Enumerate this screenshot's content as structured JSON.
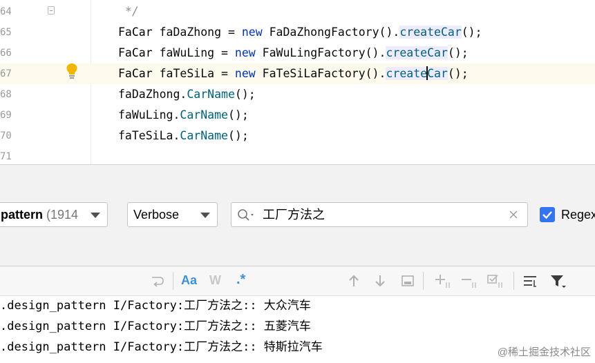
{
  "editor": {
    "lines": [
      {
        "num": "64",
        "comment": " */"
      },
      {
        "num": "65",
        "type": "FaCar",
        "var": "faDaZhong",
        "kw": "new",
        "factory": "FaDaZhongFactory",
        "method": "createCar"
      },
      {
        "num": "66",
        "type": "FaCar",
        "var": "faWuLing",
        "kw": "new",
        "factory": "FaWuLingFactory",
        "method": "createCar"
      },
      {
        "num": "67",
        "type": "FaCar",
        "var": "faTeSiLa",
        "kw": "new",
        "factory": "FaTeSiLaFactory",
        "method_a": "create",
        "method_b": "Car"
      },
      {
        "num": "68",
        "obj": "faDaZhong",
        "call": "CarName"
      },
      {
        "num": "69",
        "obj": "faWuLing",
        "call": "CarName"
      },
      {
        "num": "70",
        "obj": "faTeSiLa",
        "call": "CarName"
      },
      {
        "num": "71"
      }
    ]
  },
  "logcat": {
    "process_filter": {
      "name": "pattern",
      "count": "(1914"
    },
    "level": "Verbose",
    "search_value": "工厂方法之",
    "regex_label": "Regex",
    "regex_checked": true,
    "case_label": "Aa",
    "word_label": "W",
    "regex_toggle_label": ".*",
    "log_lines": [
      ".design_pattern I/Factory:工厂方法之:: 大众汽车",
      ".design_pattern I/Factory:工厂方法之:: 五菱汽车",
      ".design_pattern I/Factory:工厂方法之:: 特斯拉汽车"
    ]
  },
  "watermark": "@稀土掘金技术社区",
  "colors": {
    "accent": "#3574f0",
    "keyword": "#0033b3",
    "method": "#00627a"
  }
}
